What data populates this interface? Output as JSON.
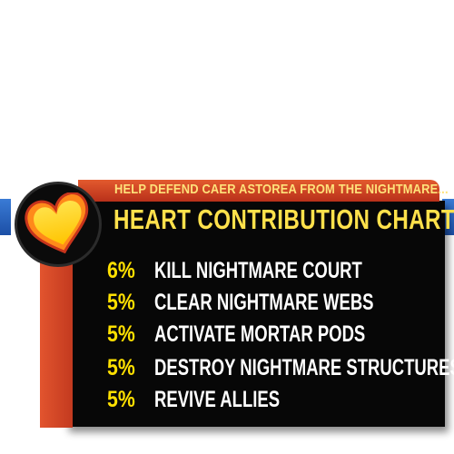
{
  "header": {
    "subtitle": "HELP DEFEND CAER ASTOREA FROM THE NIGHTMARE...",
    "title": "HEART CONTRIBUTION CHART"
  },
  "emblem": {
    "icon": "heart-icon"
  },
  "colors": {
    "accent_yellow": "#ffe000",
    "banner_red": "#d0401f",
    "panel_black": "#070707",
    "tab_blue": "#2a63c0"
  },
  "rows": [
    {
      "percent": "6%",
      "task": "KILL NIGHTMARE COURT"
    },
    {
      "percent": "5%",
      "task": "CLEAR NIGHTMARE WEBS"
    },
    {
      "percent": "5%",
      "task": "ACTIVATE MORTAR PODS"
    },
    {
      "percent": "5%",
      "task": "DESTROY NIGHTMARE STRUCTURES"
    },
    {
      "percent": "5%",
      "task": "REVIVE ALLIES"
    }
  ]
}
